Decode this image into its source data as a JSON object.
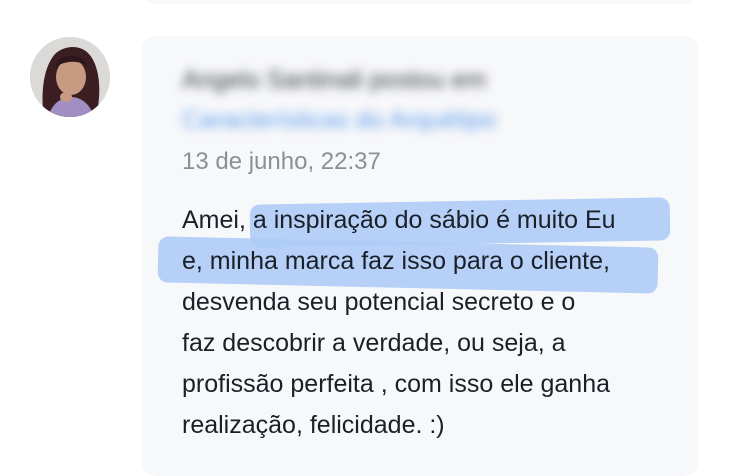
{
  "post": {
    "author_line": "Angelo Santinali postou em",
    "topic_link": "Características do Arquétipo",
    "timestamp": "13 de junho, 22:37",
    "body_lines": [
      "Amei, a inspiração do sábio é muito Eu",
      "e, minha marca faz isso para o cliente,",
      "desvenda seu potencial secreto e o",
      "faz descobrir a verdade, ou seja, a",
      "profissão perfeita , com isso ele ganha",
      "realização, felicidade. :)"
    ]
  },
  "colors": {
    "card_background": "#f7f8fa",
    "highlight": "#aecbf7",
    "link": "#2f7de8",
    "timestamp": "#8b8f96",
    "text": "#1b1f27"
  }
}
